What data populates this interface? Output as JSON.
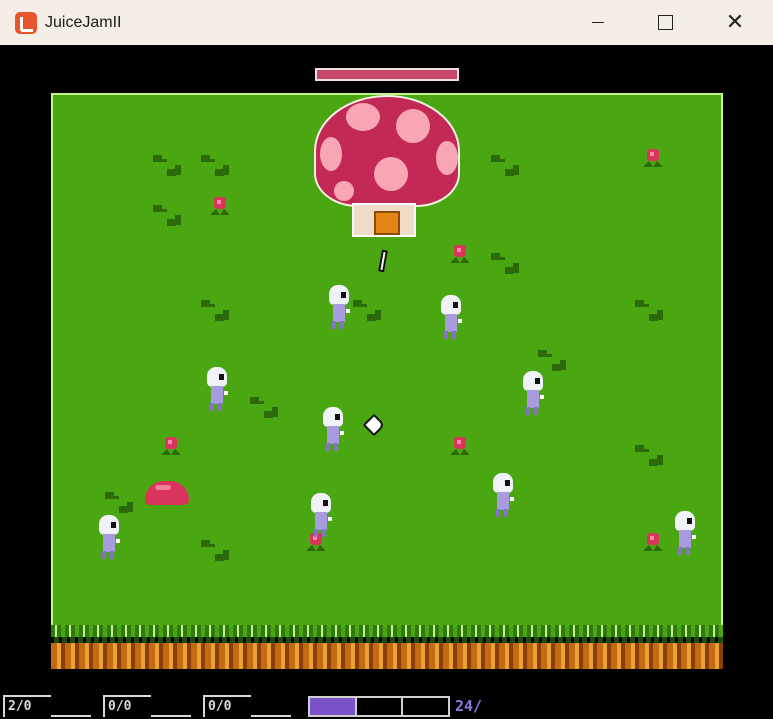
{
  "window": {
    "title": "JuiceJamII"
  },
  "boss": {
    "health_fraction": 1.0,
    "colors": {
      "bar": "#c7486a",
      "cap": "#c22954",
      "spots": "#f8a6b3"
    }
  },
  "hud": {
    "slots": [
      {
        "label": "2/0"
      },
      {
        "label": "0/0"
      },
      {
        "label": "0/0"
      }
    ],
    "energy_segments": 3,
    "energy_filled": 1,
    "counter": "24/"
  },
  "colors": {
    "grass": "#4aa712",
    "border": "#c5f28b",
    "accent": "#7b53c9"
  }
}
